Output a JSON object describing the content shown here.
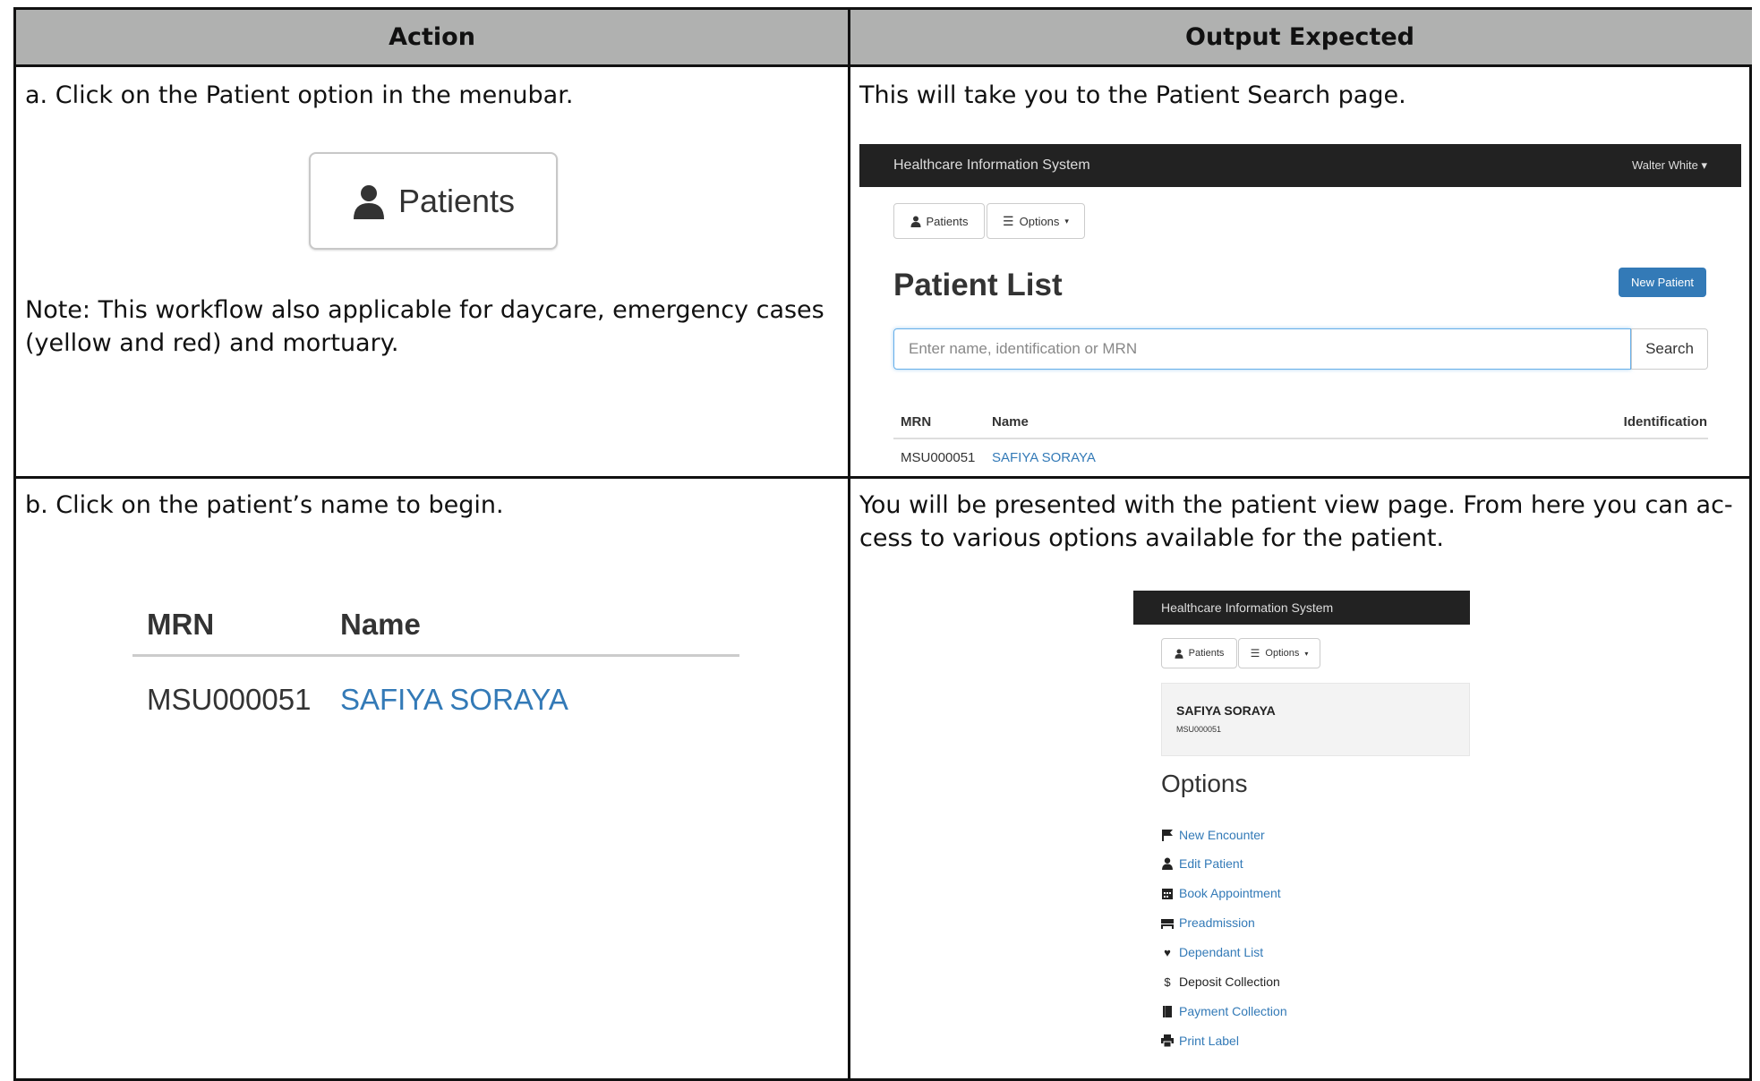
{
  "headers": {
    "action": "Action",
    "output": "Output Expected"
  },
  "row_a": {
    "action_text": "a. Click on the Patient option in the menubar.",
    "button_label": "Patients",
    "note": "Note: This workflow also applicable for daycare, emergency cases (yellow and red) and mortuary.",
    "output_text": "This will take you to the Patient Search page.",
    "screenshot": {
      "app_title": "Healthcare Information System",
      "user": "Walter White",
      "patients_btn": "Patients",
      "options_btn": "Options",
      "page_title": "Patient List",
      "new_patient_btn": "New Patient",
      "search_placeholder": "Enter name, identification or MRN",
      "search_btn": "Search",
      "columns": [
        "MRN",
        "Name",
        "Identification"
      ],
      "row": {
        "mrn": "MSU000051",
        "name": "SAFIYA SORAYA"
      }
    }
  },
  "row_b": {
    "action_text": "b. Click on the patient’s name to begin.",
    "table": {
      "col_mrn": "MRN",
      "col_name": "Name",
      "mrn": "MSU000051",
      "name": "SAFIYA SORAYA"
    },
    "output_text": "You will be presented with the patient view page. From here you can ac-cess to various options available for the patient.",
    "output_line1": "You will be presented with the patient view page. From here you can ac-",
    "output_line2": "cess to various options available for the patient.",
    "screenshot": {
      "app_title": "Healthcare Information System",
      "patients_btn": "Patients",
      "options_btn": "Options",
      "patient_name": "SAFIYA SORAYA",
      "patient_mrn": "MSU000051",
      "options_title": "Options",
      "options": [
        {
          "label": "New Encounter",
          "icon": "flag-icon",
          "link": true
        },
        {
          "label": "Edit Patient",
          "icon": "user-icon",
          "link": true
        },
        {
          "label": "Book Appointment",
          "icon": "calendar-icon",
          "link": true
        },
        {
          "label": "Preadmission",
          "icon": "bed-icon",
          "link": true
        },
        {
          "label": "Dependant List",
          "icon": "heart-icon",
          "link": true
        },
        {
          "label": "Deposit Collection",
          "icon": "dollar-icon",
          "link": false
        },
        {
          "label": "Payment Collection",
          "icon": "book-icon",
          "link": true
        },
        {
          "label": "Print Label",
          "icon": "print-icon",
          "link": true
        }
      ]
    }
  }
}
